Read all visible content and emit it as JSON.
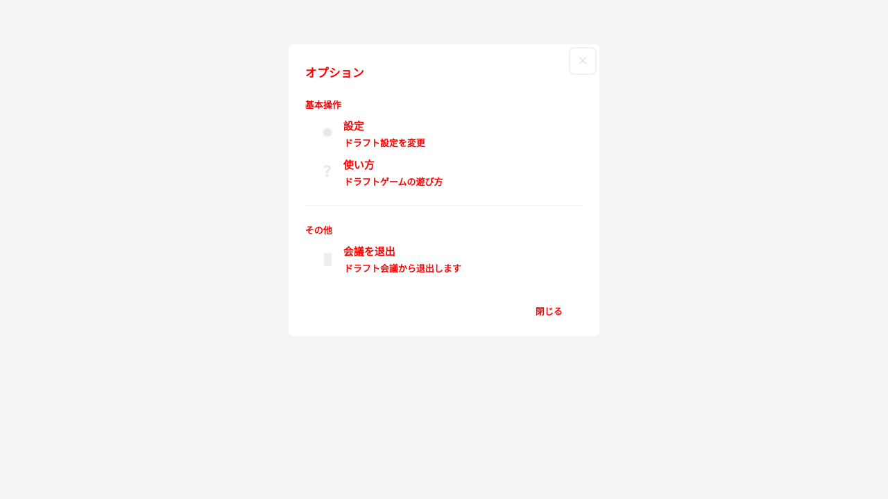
{
  "dialog": {
    "title": "オプション",
    "close_icon": "×",
    "close_label": "閉じる"
  },
  "sections": [
    {
      "label": "基本操作",
      "items": [
        {
          "icon": "gear-icon",
          "glyph": "✹",
          "title": "設定",
          "description": "ドラフト設定を変更"
        },
        {
          "icon": "question-icon",
          "glyph": "?",
          "title": "使い方",
          "description": "ドラフトゲームの遊び方"
        }
      ]
    },
    {
      "label": "その他",
      "items": [
        {
          "icon": "exit-door-icon",
          "title": "会議を退出",
          "description": "ドラフト会議から退出します"
        }
      ]
    }
  ],
  "colors": {
    "text_accent": "#ff0000",
    "background": "#f4f4f4",
    "panel": "#ffffff",
    "icon": "#e8e8e8"
  }
}
